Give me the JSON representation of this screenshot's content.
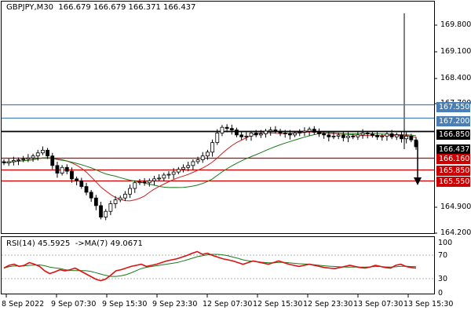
{
  "header": {
    "symbol_tf": "GBPJPY,M30",
    "open": "166.679",
    "high": "166.679",
    "low": "166.371",
    "close": "166.437"
  },
  "rsi_header": {
    "label": "RSI(14)",
    "value": "45.5925",
    "ma_label": "->MA(7)",
    "ma_value": "49.0671"
  },
  "price_axis": [
    "169.800",
    "169.100",
    "168.400",
    "167.700",
    "164.900",
    "164.200"
  ],
  "rsi_axis": [
    "100",
    "70",
    "30",
    "0"
  ],
  "time_axis": [
    "8 Sep 2022",
    "9 Sep 07:30",
    "9 Sep 15:30",
    "9 Sep 23:30",
    "12 Sep 07:30",
    "12 Sep 15:30",
    "12 Sep 23:30",
    "13 Sep 07:30",
    "13 Sep 15:30"
  ],
  "levels": [
    {
      "value": "167.550",
      "color": "#4a7fb5"
    },
    {
      "value": "167.200",
      "color": "#4a7fb5"
    },
    {
      "value": "166.850",
      "color": "#000000"
    },
    {
      "value": "166.437",
      "color": "#000000"
    },
    {
      "value": "166.160",
      "color": "#cc0000"
    },
    {
      "value": "165.850",
      "color": "#cc0000"
    },
    {
      "value": "165.550",
      "color": "#cc0000"
    }
  ],
  "chart_data": {
    "type": "candlestick",
    "symbol": "GBPJPY",
    "timeframe": "M30",
    "ylim": [
      164.2,
      170.2
    ],
    "rsi_ylim": [
      0,
      100
    ],
    "close_series": [
      166.02,
      166.05,
      166.08,
      166.1,
      166.12,
      166.15,
      166.2,
      166.28,
      166.35,
      166.2,
      165.95,
      165.75,
      165.9,
      165.8,
      165.6,
      165.55,
      165.4,
      165.25,
      165.1,
      164.9,
      164.6,
      164.75,
      164.95,
      165.05,
      165.1,
      165.2,
      165.35,
      165.5,
      165.52,
      165.5,
      165.55,
      165.6,
      165.62,
      165.7,
      165.72,
      165.78,
      165.85,
      165.9,
      165.95,
      166.05,
      166.1,
      166.2,
      166.3,
      166.55,
      166.8,
      166.95,
      166.92,
      166.88,
      166.75,
      166.7,
      166.72,
      166.8,
      166.75,
      166.78,
      166.85,
      166.88,
      166.85,
      166.8,
      166.78,
      166.75,
      166.8,
      166.82,
      166.85,
      166.9,
      166.82,
      166.78,
      166.75,
      166.7,
      166.72,
      166.75,
      166.68,
      166.72,
      166.7,
      166.75,
      166.8,
      166.78,
      166.74,
      166.7,
      166.72,
      166.78,
      166.7,
      166.75,
      166.65,
      166.72,
      166.62,
      166.44
    ],
    "rsi_series": [
      45,
      50,
      52,
      48,
      50,
      55,
      52,
      48,
      40,
      35,
      38,
      42,
      40,
      42,
      45,
      40,
      35,
      30,
      25,
      22,
      25,
      32,
      40,
      42,
      45,
      48,
      50,
      52,
      48,
      50,
      52,
      55,
      58,
      60,
      62,
      65,
      68,
      72,
      75,
      70,
      72,
      68,
      65,
      62,
      60,
      58,
      55,
      52,
      55,
      58,
      56,
      54,
      52,
      55,
      58,
      55,
      52,
      50,
      48,
      50,
      52,
      50,
      48,
      46,
      45,
      44,
      46,
      48,
      50,
      48,
      46,
      45,
      47,
      50,
      48,
      46,
      45,
      50,
      52,
      48,
      46,
      45
    ],
    "levels": [
      167.55,
      167.2,
      166.85,
      166.16,
      165.85,
      165.55
    ]
  }
}
